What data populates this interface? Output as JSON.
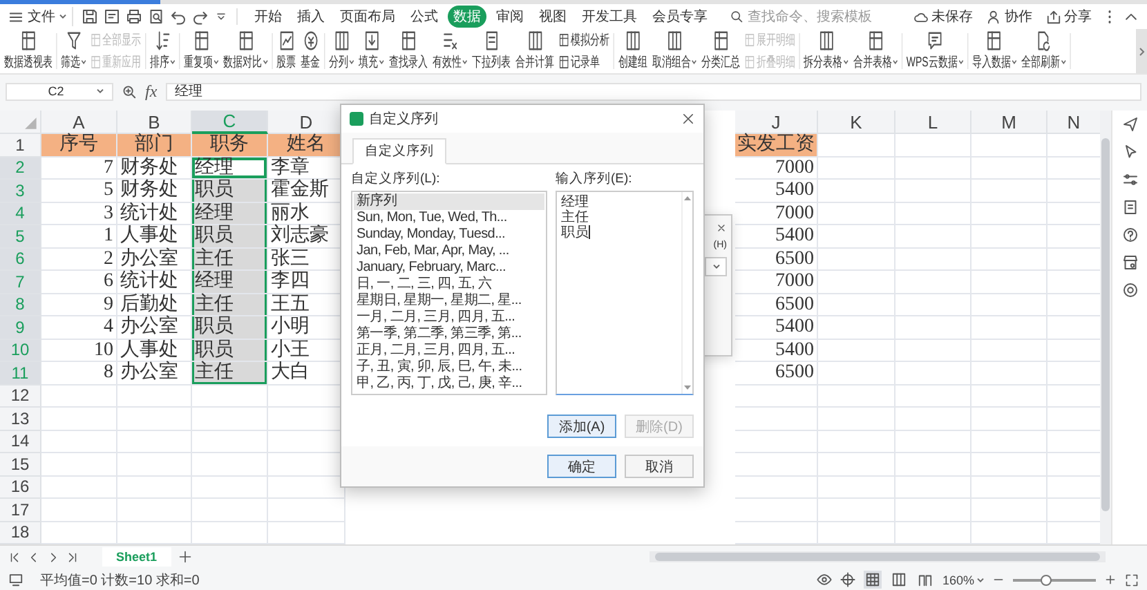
{
  "menu": {
    "file": "文件",
    "tabs": [
      {
        "label": "开始",
        "selected": false
      },
      {
        "label": "插入",
        "selected": false
      },
      {
        "label": "页面布局",
        "selected": false
      },
      {
        "label": "公式",
        "selected": false
      },
      {
        "label": "数据",
        "selected": true
      },
      {
        "label": "审阅",
        "selected": false
      },
      {
        "label": "视图",
        "selected": false
      },
      {
        "label": "开发工具",
        "selected": false
      },
      {
        "label": "会员专享",
        "selected": false
      }
    ],
    "search": {
      "placeholder": "查找命令、搜索模板"
    },
    "actions": [
      "未保存",
      "协作",
      "分享"
    ]
  },
  "ribbon": [
    {
      "items": [
        {
          "kind": "large",
          "label": "数据透视表",
          "dropdown": false
        }
      ]
    },
    {
      "items": [
        {
          "kind": "large",
          "label": "筛选",
          "dropdown": true
        },
        {
          "kind": "stack",
          "items": [
            {
              "label": "全部显示",
              "disabled": true
            },
            {
              "label": "重新应用",
              "disabled": true
            }
          ]
        }
      ]
    },
    {
      "items": [
        {
          "kind": "large",
          "label": "排序",
          "dropdown": true
        }
      ]
    },
    {
      "items": [
        {
          "kind": "large",
          "label": "重复项",
          "dropdown": true
        },
        {
          "kind": "large",
          "label": "数据对比",
          "dropdown": true
        }
      ]
    },
    {
      "items": [
        {
          "kind": "large",
          "label": "股票",
          "dropdown": false
        },
        {
          "kind": "large",
          "label": "基金",
          "dropdown": false
        }
      ]
    },
    {
      "items": [
        {
          "kind": "large",
          "label": "分列",
          "dropdown": true
        },
        {
          "kind": "large",
          "label": "填充",
          "dropdown": true
        },
        {
          "kind": "large",
          "label": "查找录入",
          "dropdown": false
        },
        {
          "kind": "large",
          "label": "有效性",
          "dropdown": true
        },
        {
          "kind": "large",
          "label": "下拉列表",
          "dropdown": false
        },
        {
          "kind": "large",
          "label": "合并计算",
          "dropdown": false
        },
        {
          "kind": "stack",
          "items": [
            {
              "label": "模拟分析",
              "disabled": false
            },
            {
              "label": "记录单",
              "disabled": false
            }
          ]
        }
      ]
    },
    {
      "items": [
        {
          "kind": "large",
          "label": "创建组",
          "dropdown": false
        },
        {
          "kind": "large",
          "label": "取消组合",
          "dropdown": true
        },
        {
          "kind": "large",
          "label": "分类汇总",
          "dropdown": false
        },
        {
          "kind": "stack",
          "items": [
            {
              "label": "展开明细",
              "disabled": true
            },
            {
              "label": "折叠明细",
              "disabled": true
            }
          ]
        }
      ]
    },
    {
      "items": [
        {
          "kind": "large",
          "label": "拆分表格",
          "dropdown": true
        },
        {
          "kind": "large",
          "label": "合并表格",
          "dropdown": true
        }
      ]
    },
    {
      "items": [
        {
          "kind": "large",
          "label": "WPS云数据",
          "dropdown": true
        }
      ]
    },
    {
      "items": [
        {
          "kind": "large",
          "label": "导入数据",
          "dropdown": true
        },
        {
          "kind": "large",
          "label": "全部刷新",
          "dropdown": true
        }
      ]
    }
  ],
  "formula_bar": {
    "cell": "C2",
    "fx": "fx",
    "value": "经理"
  },
  "sheet": {
    "columns": [
      {
        "label": "A",
        "kind": "number",
        "selected": false
      },
      {
        "label": "B",
        "kind": "text",
        "selected": false
      },
      {
        "label": "C",
        "kind": "text",
        "selected": true
      },
      {
        "label": "D",
        "kind": "text",
        "selected": false
      },
      {
        "label": "J",
        "kind": "number",
        "selected": false
      },
      {
        "label": "K",
        "kind": "text",
        "selected": false
      },
      {
        "label": "L",
        "kind": "text",
        "selected": false
      },
      {
        "label": "M",
        "kind": "text",
        "selected": false
      },
      {
        "label": "N",
        "kind": "text",
        "selected": false
      }
    ],
    "rows": [
      {
        "number": "1",
        "kind": "header",
        "selected": false,
        "active": false,
        "cells": [
          "序号",
          "部门",
          "职务",
          "姓名",
          "实发工资"
        ]
      },
      {
        "number": "2",
        "kind": "data",
        "selected": true,
        "active": true,
        "cells": [
          "7",
          "财务处",
          "经理",
          "李章",
          "7000"
        ]
      },
      {
        "number": "3",
        "kind": "data",
        "selected": true,
        "active": false,
        "cells": [
          "5",
          "财务处",
          "职员",
          "霍金斯",
          "5400"
        ]
      },
      {
        "number": "4",
        "kind": "data",
        "selected": true,
        "active": false,
        "cells": [
          "3",
          "统计处",
          "经理",
          "丽水",
          "7000"
        ]
      },
      {
        "number": "5",
        "kind": "data",
        "selected": true,
        "active": false,
        "cells": [
          "1",
          "人事处",
          "职员",
          "刘志豪",
          "5400"
        ]
      },
      {
        "number": "6",
        "kind": "data",
        "selected": true,
        "active": false,
        "cells": [
          "2",
          "办公室",
          "主任",
          "张三",
          "6500"
        ]
      },
      {
        "number": "7",
        "kind": "data",
        "selected": true,
        "active": false,
        "cells": [
          "6",
          "统计处",
          "经理",
          "李四",
          "7000"
        ]
      },
      {
        "number": "8",
        "kind": "data",
        "selected": true,
        "active": false,
        "cells": [
          "9",
          "后勤处",
          "主任",
          "王五",
          "6500"
        ]
      },
      {
        "number": "9",
        "kind": "data",
        "selected": true,
        "active": false,
        "cells": [
          "4",
          "办公室",
          "职员",
          "小明",
          "5400"
        ]
      },
      {
        "number": "10",
        "kind": "data",
        "selected": true,
        "active": false,
        "cells": [
          "10",
          "人事处",
          "职员",
          "小王",
          "5400"
        ]
      },
      {
        "number": "11",
        "kind": "data",
        "selected": true,
        "active": false,
        "cells": [
          "8",
          "办公室",
          "主任",
          "大白",
          "6500"
        ]
      },
      {
        "number": "12",
        "kind": "blank",
        "selected": false,
        "active": false
      },
      {
        "number": "13",
        "kind": "blank",
        "selected": false,
        "active": false
      },
      {
        "number": "14",
        "kind": "blank",
        "selected": false,
        "active": false
      },
      {
        "number": "15",
        "kind": "blank",
        "selected": false,
        "active": false
      },
      {
        "number": "16",
        "kind": "blank",
        "selected": false,
        "active": false
      },
      {
        "number": "17",
        "kind": "blank",
        "selected": false,
        "active": false
      },
      {
        "number": "18",
        "kind": "blank",
        "selected": false,
        "active": false
      }
    ]
  },
  "sheet_tabs": [
    {
      "label": "Sheet1",
      "selected": true
    }
  ],
  "status_bar": {
    "summary": "平均值=0 计数=10 求和=0",
    "views": [
      {
        "kind": "normal",
        "selected": true
      },
      {
        "kind": "page",
        "selected": false
      },
      {
        "kind": "break",
        "selected": false
      }
    ],
    "zoom": "160%",
    "level": 0.4
  },
  "background_dialog": {
    "label": "(H)"
  },
  "dialog": {
    "title": "自定义序列",
    "tabs": [
      {
        "label": "自定义序列",
        "selected": true
      }
    ],
    "list_label": "自定义序列(L):",
    "list": [
      {
        "label": "新序列",
        "selected": true
      },
      {
        "label": "Sun, Mon, Tue, Wed, Th...",
        "selected": false
      },
      {
        "label": "Sunday, Monday, Tuesd...",
        "selected": false
      },
      {
        "label": "Jan, Feb, Mar, Apr, May, ...",
        "selected": false
      },
      {
        "label": "January, February, Marc...",
        "selected": false
      },
      {
        "label": "日, 一, 二, 三, 四, 五, 六",
        "selected": false
      },
      {
        "label": "星期日, 星期一, 星期二, 星...",
        "selected": false
      },
      {
        "label": "一月, 二月, 三月, 四月, 五...",
        "selected": false
      },
      {
        "label": "第一季, 第二季, 第三季, 第...",
        "selected": false
      },
      {
        "label": "正月, 二月, 三月, 四月, 五...",
        "selected": false
      },
      {
        "label": "子, 丑, 寅, 卯, 辰, 巳, 午, 未...",
        "selected": false
      },
      {
        "label": "甲, 乙, 丙, 丁, 戊, 己, 庚, 辛...",
        "selected": false
      }
    ],
    "input_label": "输入序列(E):",
    "input_lines": [
      "经理",
      "主任",
      "职员"
    ],
    "buttons": [
      {
        "label": "添加(A)",
        "disabled": false,
        "focused": true
      },
      {
        "label": "删除(D)",
        "disabled": true,
        "focused": false
      }
    ],
    "footer": [
      {
        "label": "确定",
        "focused": true
      },
      {
        "label": "取消",
        "focused": false
      }
    ]
  }
}
